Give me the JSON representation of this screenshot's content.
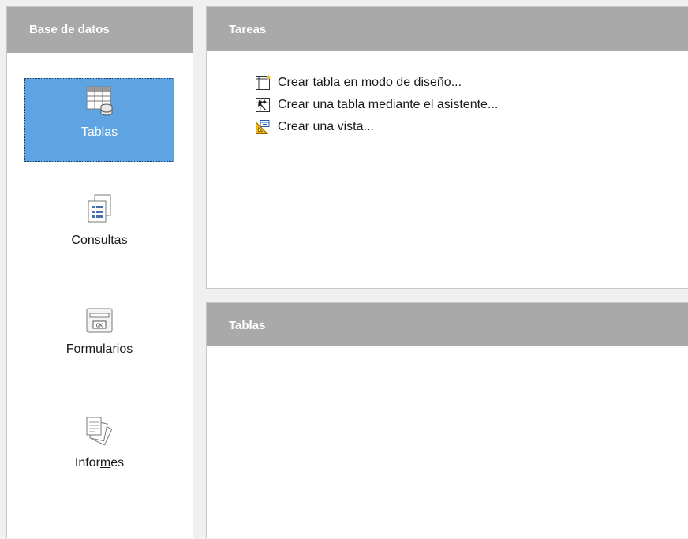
{
  "sidebar": {
    "header": "Base de datos",
    "items": [
      {
        "pre": "",
        "key": "T",
        "post": "ablas",
        "icon": "tables-icon",
        "selected": true
      },
      {
        "pre": "",
        "key": "C",
        "post": "onsultas",
        "icon": "queries-icon",
        "selected": false
      },
      {
        "pre": "",
        "key": "F",
        "post": "ormularios",
        "icon": "forms-icon",
        "selected": false
      },
      {
        "pre": "Infor",
        "key": "m",
        "post": "es",
        "icon": "reports-icon",
        "selected": false
      }
    ]
  },
  "tasks": {
    "header": "Tareas",
    "items": [
      {
        "label": "Crear tabla en modo de diseño...",
        "icon": "design-table-icon"
      },
      {
        "label": "Crear una tabla mediante el asistente...",
        "icon": "wizard-icon"
      },
      {
        "label": "Crear una vista...",
        "icon": "create-view-icon"
      }
    ]
  },
  "content": {
    "header": "Tablas"
  },
  "colors": {
    "header_bg": "#a9a9a9",
    "selected_bg": "#5ea4e3",
    "panel_bg": "#ffffff"
  }
}
